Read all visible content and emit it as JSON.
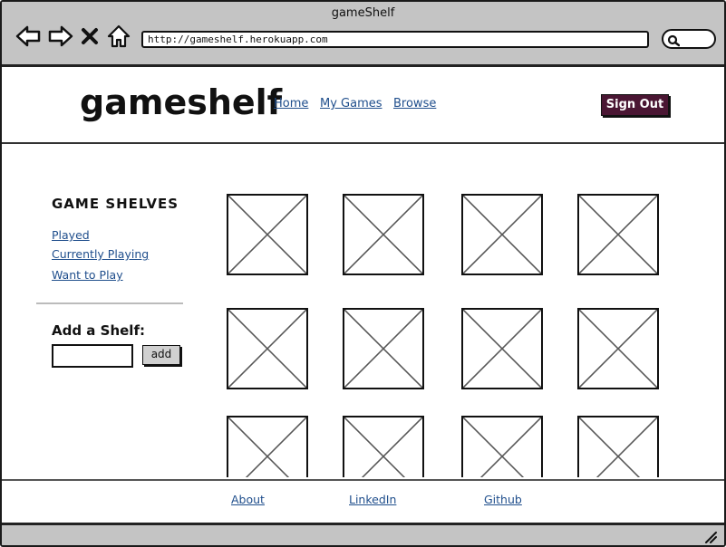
{
  "window": {
    "title": "gameShelf"
  },
  "browser": {
    "url": "http://gameshelf.herokuapp.com",
    "icons": [
      "back-arrow-icon",
      "forward-arrow-icon",
      "close-x-icon",
      "home-icon",
      "search-icon"
    ]
  },
  "header": {
    "logo": "gameshelf",
    "nav": [
      "Home",
      "My Games",
      "Browse"
    ],
    "sign_out": "Sign Out"
  },
  "sidebar": {
    "title": "GAME SHELVES",
    "shelves": [
      "Played",
      "Currently Playing",
      "Want to Play"
    ],
    "add_title": "Add a Shelf:",
    "add_input_value": "",
    "add_button": "add"
  },
  "grid": {
    "tile_count": 12,
    "tile_icon": "image-placeholder-icon"
  },
  "footer": {
    "links": [
      "About",
      "LinkedIn",
      "Github"
    ]
  },
  "colors": {
    "chrome": "#c4c4c4",
    "sign_out_bg": "#4a1633",
    "link": "#1f4e8c"
  }
}
